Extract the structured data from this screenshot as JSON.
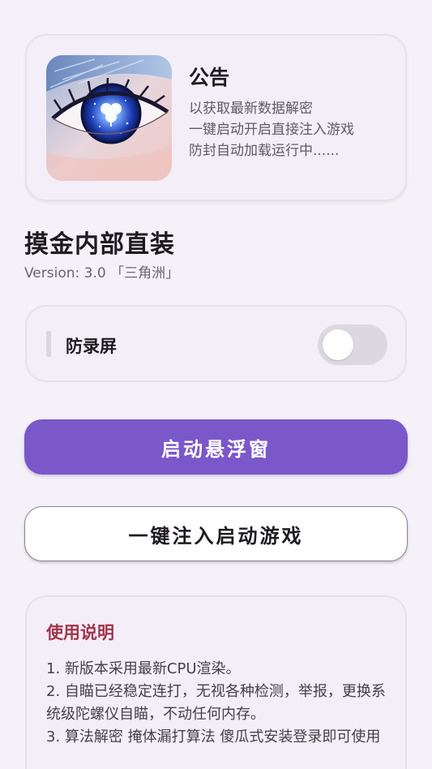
{
  "notice": {
    "title": "公告",
    "lines": [
      "以获取最新数据解密",
      "一键启动开启直接注入游戏",
      "防封自动加载运行中......"
    ],
    "image_icon": "eye-with-clover-icon"
  },
  "app": {
    "title": "摸金内部直装",
    "version": "Version: 3.0 「三角洲」"
  },
  "settings": {
    "anti_record_label": "防录屏",
    "anti_record_enabled": false
  },
  "buttons": {
    "float_window": "启动悬浮窗",
    "inject_launch": "一键注入启动游戏"
  },
  "instructions": {
    "title": "使用说明",
    "items": [
      "1. 新版本采用最新CPU渲染。",
      "2. 自瞄已经稳定连打，无视各种检测，举报，更换系统级陀螺仪自瞄，不动任何内存。",
      "3. 算法解密 掩体漏打算法 傻瓜式安装登录即可使用"
    ]
  },
  "colors": {
    "background": "#f5f1f9",
    "card": "#f3eef7",
    "primary": "#7b58c9",
    "instruction_title": "#a0344d"
  }
}
